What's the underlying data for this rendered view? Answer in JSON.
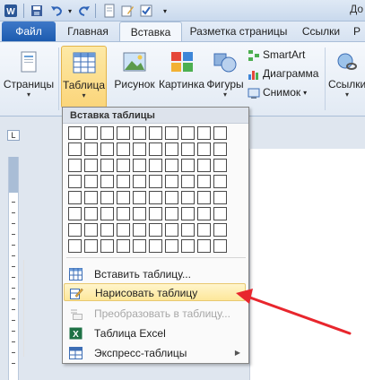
{
  "title_bar": {
    "doc_title_fragment": "До"
  },
  "tabs": {
    "file": "Файл",
    "home": "Главная",
    "insert": "Вставка",
    "page_layout": "Разметка страницы",
    "references": "Ссылки",
    "mailings": "Р"
  },
  "ribbon": {
    "pages": "Страницы",
    "table": "Таблица",
    "picture": "Рисунок",
    "clipart": "Картинка",
    "shapes": "Фигуры",
    "smartart": "SmartArt",
    "chart": "Диаграмма",
    "screenshot": "Снимок",
    "links": "Ссылки"
  },
  "table_menu": {
    "header": "Вставка таблицы",
    "grid_columns": 10,
    "grid_rows": 8,
    "items": [
      {
        "name": "insert-table",
        "label": "Вставить таблицу...",
        "enabled": true,
        "highlighted": false
      },
      {
        "name": "draw-table",
        "label": "Нарисовать таблицу",
        "enabled": true,
        "highlighted": true
      },
      {
        "name": "convert-to-table",
        "label": "Преобразовать в таблицу...",
        "enabled": false,
        "highlighted": false
      },
      {
        "name": "excel-table",
        "label": "Таблица Excel",
        "enabled": true,
        "highlighted": false
      },
      {
        "name": "quick-tables",
        "label": "Экспресс-таблицы",
        "enabled": true,
        "highlighted": false,
        "has_submenu": true
      }
    ]
  },
  "colors": {
    "accent_blue": "#1b5aae",
    "highlight": "#fde79a",
    "arrow": "#e8262d"
  }
}
